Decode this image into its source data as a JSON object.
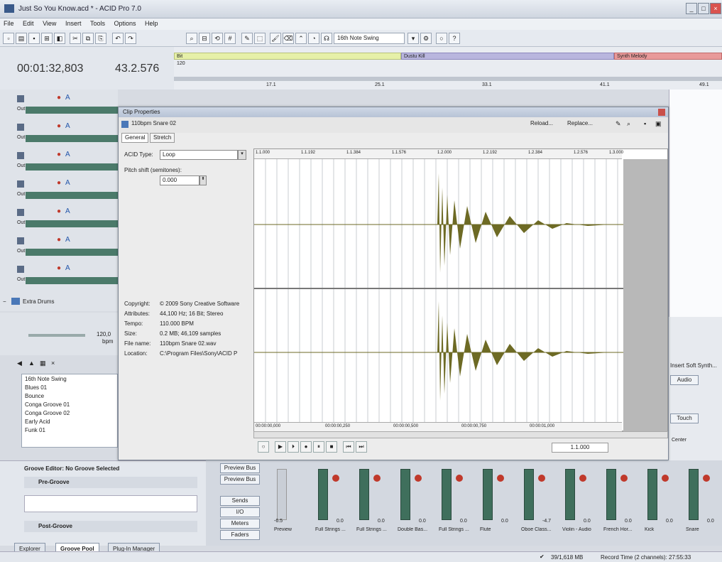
{
  "window": {
    "title": "Just So You Know.acd * - ACID Pro 7.0",
    "min": "_",
    "max": "□",
    "close": "×"
  },
  "menu": [
    "File",
    "Edit",
    "View",
    "Insert",
    "Tools",
    "Options",
    "Help"
  ],
  "toolbar": {
    "groove_select": "16th Note Swing"
  },
  "transport_display": {
    "time": "00:01:32,803",
    "beat": "43.2.576"
  },
  "ruler": {
    "tempo": "120",
    "regions": [
      {
        "label": "Bit"
      },
      {
        "label": "Dustu Kill"
      },
      {
        "label": "Synth Melody"
      }
    ],
    "markers": [
      "17.1",
      "25.1",
      "33.1",
      "41.1",
      "49.1"
    ]
  },
  "tracks": [
    {
      "out": "Out"
    },
    {
      "out": "Out"
    },
    {
      "out": "Out"
    },
    {
      "out": "Out"
    },
    {
      "out": "Out"
    },
    {
      "out": "Out"
    },
    {
      "out": "Out"
    }
  ],
  "track_extra": "Extra Drums",
  "tempo_panel": {
    "value": "120,0",
    "unit": "bpm"
  },
  "explorer_items": [
    "16th Note Swing",
    "Blues 01",
    "Bounce",
    "Conga Groove 01",
    "Conga Groove 02",
    "Early Acid",
    "Funk 01"
  ],
  "groove": {
    "title": "Groove Editor: No Groove Selected",
    "pre": "Pre-Groove",
    "post": "Post-Groove"
  },
  "tabs": [
    "Explorer",
    "Groove Pool",
    "Plug-In Manager"
  ],
  "clip": {
    "title": "Clip Properties",
    "file": "110bpm Snare 02",
    "reload": "Reload...",
    "replace": "Replace...",
    "tabs": [
      "General",
      "Stretch"
    ],
    "acid_type_label": "ACID Type:",
    "acid_type": "Loop",
    "pitch_label": "Pitch shift (semitones):",
    "pitch_value": "0.000",
    "info_labels": [
      "Copyright:",
      "Attributes:",
      "Tempo:",
      "Size:",
      "File name:",
      "Location:"
    ],
    "info_values": [
      "© 2009 Sony Creative Software",
      "44,100 Hz; 16 Bit; Stereo",
      "110.000 BPM",
      "0.2 MB; 46,109 samples",
      "110bpm Snare 02.wav",
      "C:\\Program Files\\Sony\\ACID P"
    ],
    "ruler_ticks": [
      "1.1.000",
      "1.1.192",
      "1.1.384",
      "1.1.576",
      "1.2.000",
      "1.2.192",
      "1.2.384",
      "1.2.576",
      "1.3.000"
    ],
    "time_ticks": [
      "00:00:00,000",
      "00:00:00,250",
      "00:00:00,500",
      "00:00:00,750",
      "00:00:01,000"
    ],
    "transport_value": "1.1.000"
  },
  "mixer": {
    "buses": [
      "Preview Bus",
      "Preview Bus"
    ],
    "buttons": [
      "Sends",
      "I/O",
      "Meters",
      "Faders"
    ],
    "channels": [
      "Preview",
      "Full Strings ...",
      "Full Strings ...",
      "Double Bas...",
      "Full Strings ...",
      "Flute",
      "Oboe Class...",
      "Violin - Audio",
      "French Hor...",
      "Kick",
      "Snare"
    ],
    "values": [
      "-6.5",
      "0.0",
      "0.0",
      "0.0",
      "0.0",
      "0.0",
      "-4.7",
      "0.0",
      "0.0",
      "0.0",
      "0.0"
    ]
  },
  "right_panel": {
    "insert": "Insert Soft Synth...",
    "audio": "Audio",
    "touch": "Touch",
    "center": "Center"
  },
  "status": {
    "mem": "39/1,618 MB",
    "record": "Record Time (2 channels): 27:55:33"
  },
  "colors": {
    "region1": "#e6f0a8",
    "region2": "#b9b6de",
    "region3": "#e89a9a",
    "wave": "#6d6a24",
    "meter": "#4b7a6a"
  }
}
